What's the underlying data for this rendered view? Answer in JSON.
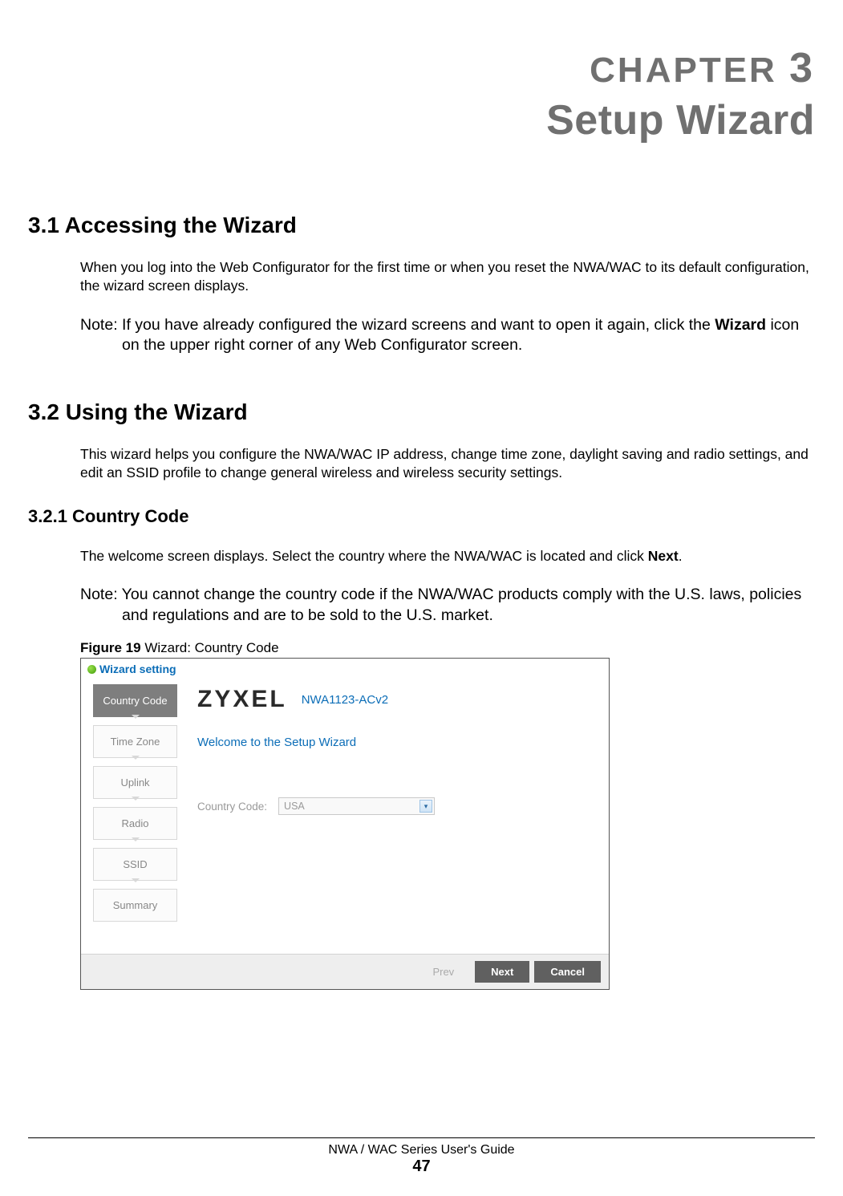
{
  "chapter": {
    "word": "CHAPTER",
    "number": "3",
    "title": "Setup Wizard"
  },
  "sec_3_1": {
    "heading": "3.1  Accessing the Wizard",
    "para1": "When you log into the Web Configurator for the first time or when you reset the NWA/WAC to its default configuration, the wizard screen displays.",
    "note_prefix": "Note: If you have already configured the wizard screens and want to open it again, click the ",
    "note_bold": "Wizard",
    "note_suffix": " icon on the upper right corner of any Web Configurator screen."
  },
  "sec_3_2": {
    "heading": "3.2  Using the Wizard",
    "para1": "This wizard helps you configure the NWA/WAC IP address, change time zone, daylight saving and radio settings, and edit an SSID profile to change general wireless and wireless security settings."
  },
  "sec_3_2_1": {
    "heading": "3.2.1  Country Code",
    "para_prefix": "The welcome screen displays. Select the country where the NWA/WAC is located and click ",
    "para_bold": "Next",
    "para_suffix": ".",
    "note": "Note: You cannot change the country code if the NWA/WAC products comply with the U.S. laws, policies and regulations and are to be sold to the U.S. market."
  },
  "figure": {
    "label": "Figure 19",
    "caption": "   Wizard: Country Code"
  },
  "wizard": {
    "window_title": "Wizard setting",
    "steps": [
      "Country Code",
      "Time Zone",
      "Uplink",
      "Radio",
      "SSID",
      "Summary"
    ],
    "active_step_index": 0,
    "brand": "ZYXEL",
    "model": "NWA1123-ACv2",
    "welcome": "Welcome to the Setup Wizard",
    "field_label": "Country Code:",
    "field_value": "USA",
    "buttons": {
      "prev": "Prev",
      "next": "Next",
      "cancel": "Cancel"
    }
  },
  "footer": {
    "guide": "NWA / WAC Series User's Guide",
    "page": "47"
  }
}
